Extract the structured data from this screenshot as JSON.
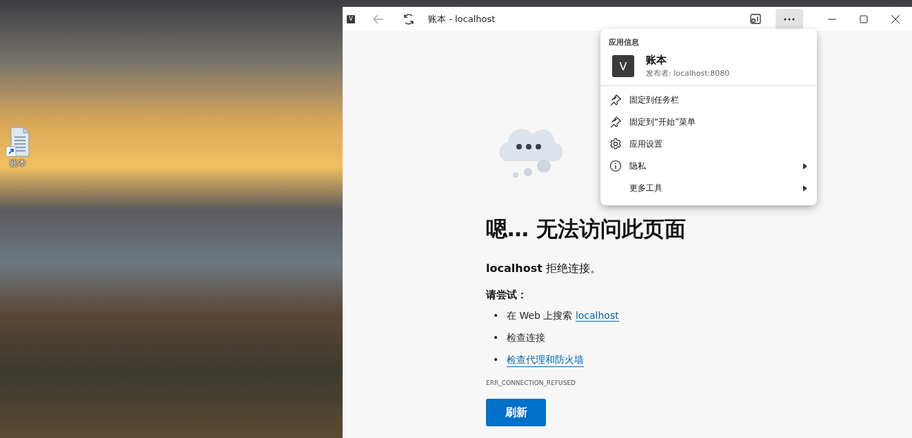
{
  "desktop": {
    "icons": [
      {
        "label": "账本"
      }
    ]
  },
  "window": {
    "app_icon": "V",
    "title": "账本 - localhost"
  },
  "menu": {
    "heading": "应用信息",
    "app": {
      "icon": "V",
      "name": "账本",
      "publisher": "发布者: localhost:8080"
    },
    "items": [
      {
        "kind": "pin",
        "label": "固定到任务栏",
        "submenu": false
      },
      {
        "kind": "pin",
        "label": "固定到“开始”菜单",
        "submenu": false
      },
      {
        "kind": "gear",
        "label": "应用设置",
        "submenu": false
      },
      {
        "kind": "info",
        "label": "隐私",
        "submenu": true
      },
      {
        "kind": "none",
        "label": "更多工具",
        "submenu": true
      }
    ]
  },
  "page": {
    "heading": "嗯… 无法访问此页面",
    "message": "**localhost** 拒绝连接。",
    "try_label": "请尝试：",
    "suggestions": [
      {
        "kind": "text_link",
        "bullet": "•",
        "text": "在 Web 上搜索 ",
        "link": "localhost"
      },
      {
        "kind": "text",
        "bullet": "•",
        "text": "检查连接"
      },
      {
        "kind": "link",
        "bullet": "•",
        "link": "检查代理和防火墙"
      }
    ],
    "error_code": "ERR_CONNECTION_REFUSED",
    "button": "刷新"
  }
}
